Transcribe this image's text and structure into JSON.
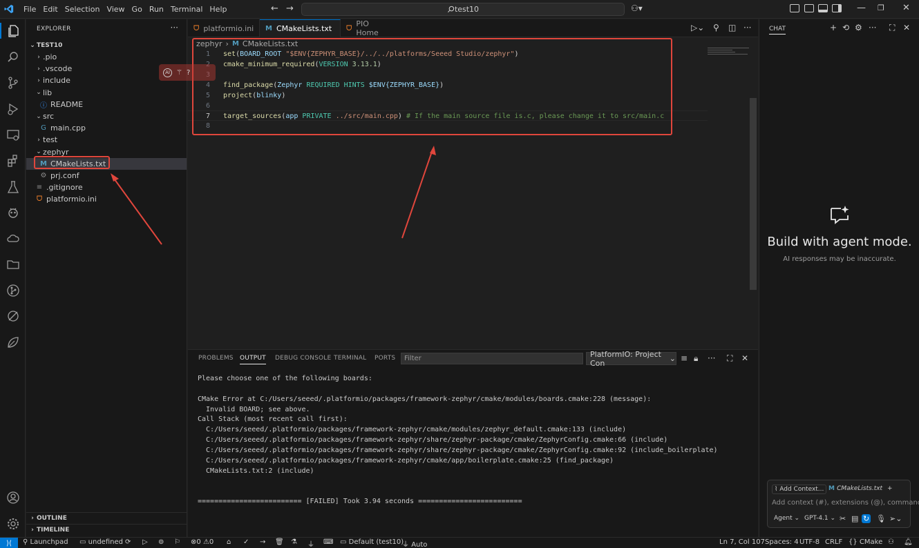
{
  "menu": [
    "File",
    "Edit",
    "Selection",
    "View",
    "Go",
    "Run",
    "Terminal",
    "Help"
  ],
  "command_center": "test10",
  "explorer": {
    "title": "EXPLORER",
    "workspace": "TEST10",
    "tree": [
      {
        "label": ".pio",
        "type": "folder",
        "open": false,
        "depth": 1
      },
      {
        "label": ".vscode",
        "type": "folder",
        "open": false,
        "depth": 1
      },
      {
        "label": "include",
        "type": "folder",
        "open": false,
        "depth": 1
      },
      {
        "label": "lib",
        "type": "folder",
        "open": true,
        "depth": 1
      },
      {
        "label": "README",
        "type": "info",
        "depth": 2
      },
      {
        "label": "src",
        "type": "folder",
        "open": true,
        "depth": 1
      },
      {
        "label": "main.cpp",
        "type": "cpp",
        "depth": 2
      },
      {
        "label": "test",
        "type": "folder",
        "open": false,
        "depth": 1
      },
      {
        "label": "zephyr",
        "type": "folder",
        "open": true,
        "depth": 1
      },
      {
        "label": "CMakeLists.txt",
        "type": "cmake",
        "depth": 2,
        "selected": true
      },
      {
        "label": "prj.conf",
        "type": "gear",
        "depth": 2
      },
      {
        "label": ".gitignore",
        "type": "lines",
        "depth": 1
      },
      {
        "label": "platformio.ini",
        "type": "pio",
        "depth": 1
      }
    ],
    "outline": "OUTLINE",
    "timeline": "TIMELINE"
  },
  "tabs": [
    {
      "label": "platformio.ini",
      "icon": "pio-icon",
      "active": false
    },
    {
      "label": "CMakeLists.txt",
      "icon": "cmake-icon",
      "active": true
    },
    {
      "label": "PIO Home",
      "icon": "pio-icon",
      "active": false
    }
  ],
  "breadcrumb": [
    "zephyr",
    "CMakeLists.txt"
  ],
  "code_lines": [
    {
      "n": "1",
      "html": "<span class=\"fn\">set</span>(<span class=\"var\">BOARD_ROOT</span> <span class=\"str\">\"$ENV{ZEPHYR_BASE}/../../platforms/Seeed Studio/zephyr\"</span>)"
    },
    {
      "n": "2",
      "html": "<span class=\"fn\">cmake_minimum_required</span>(<span class=\"kw\">VERSION</span> <span class=\"num\">3.13.1</span>)"
    },
    {
      "n": "3",
      "html": ""
    },
    {
      "n": "4",
      "html": "<span class=\"fn\">find_package</span>(<span class=\"var\">Zephyr</span> <span class=\"kw\">REQUIRED HINTS</span> <span class=\"var\">$ENV{ZEPHYR_BASE}</span>)"
    },
    {
      "n": "5",
      "html": "<span class=\"fn\">project</span>(<span class=\"var\">blinky</span>)"
    },
    {
      "n": "6",
      "html": ""
    },
    {
      "n": "7",
      "html": "<span class=\"fn\">target_sources</span>(<span class=\"var\">app</span> <span class=\"kw\">PRIVATE</span> <span class=\"str\">../src/main.cpp</span>) <span class=\"cmt\"># If the main source file is.c, please change it to src/main.c</span>",
      "current": true
    },
    {
      "n": "8",
      "html": ""
    }
  ],
  "panel": {
    "tabs": [
      "PROBLEMS",
      "OUTPUT",
      "DEBUG CONSOLE",
      "TERMINAL",
      "PORTS"
    ],
    "active_tab": "OUTPUT",
    "filter_placeholder": "Filter",
    "channel": "PlatformIO: Project Con",
    "output": [
      "Please choose one of the following boards:",
      "",
      "CMake Error at C:/Users/seeed/.platformio/packages/framework-zephyr/cmake/modules/boards.cmake:228 (message):",
      "  Invalid BOARD; see above.",
      "Call Stack (most recent call first):",
      "  C:/Users/seeed/.platformio/packages/framework-zephyr/cmake/modules/zephyr_default.cmake:133 (include)",
      "  C:/Users/seeed/.platformio/packages/framework-zephyr/share/zephyr-package/cmake/ZephyrConfig.cmake:66 (include)",
      "  C:/Users/seeed/.platformio/packages/framework-zephyr/share/zephyr-package/cmake/ZephyrConfig.cmake:92 (include_boilerplate)",
      "  C:/Users/seeed/.platformio/packages/framework-zephyr/cmake/app/boilerplate.cmake:25 (find_package)",
      "  CMakeLists.txt:2 (include)",
      "",
      "",
      "========================= [FAILED] Took 3.94 seconds ========================="
    ]
  },
  "chat": {
    "title": "CHAT",
    "heading": "Build with agent mode.",
    "subtitle": "AI responses may be inaccurate.",
    "add_context": "Add Context...",
    "context_file": "CMakeLists.txt",
    "placeholder": "Add context (#), extensions (@), commands",
    "mode": "Agent",
    "model": "GPT-4.1"
  },
  "status": {
    "launchpad": "Launchpad",
    "undefined": "undefined",
    "errors": "0",
    "warnings": "0",
    "env": "Default (test10)",
    "port": "Auto",
    "position": "Ln 7, Col 107",
    "spaces": "Spaces: 4",
    "encoding": "UTF-8",
    "eol": "CRLF",
    "language": "CMake"
  },
  "colors": {
    "accent": "#0078d4",
    "annotation": "#e0463c",
    "pio": "#f5822a"
  }
}
